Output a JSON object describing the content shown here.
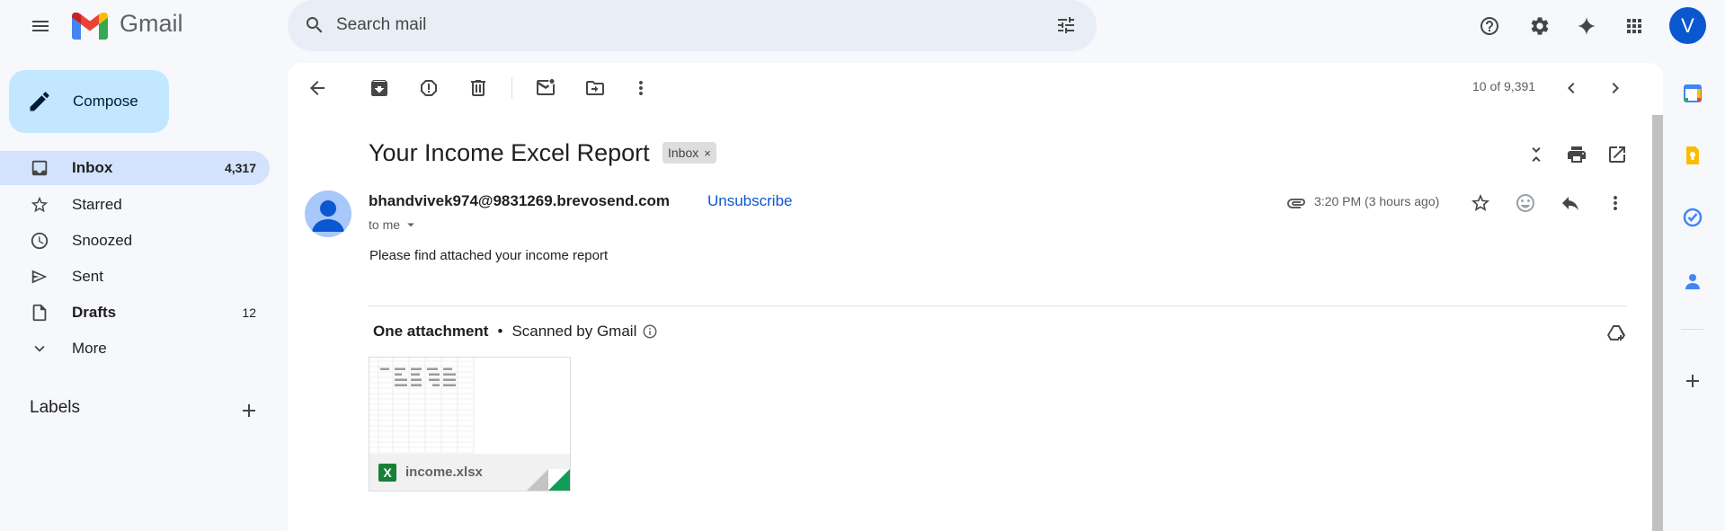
{
  "app": {
    "name": "Gmail",
    "avatar_initial": "V"
  },
  "search": {
    "placeholder": "Search mail"
  },
  "compose": {
    "label": "Compose"
  },
  "sidebar": {
    "items": [
      {
        "label": "Inbox",
        "count": "4,317"
      },
      {
        "label": "Starred",
        "count": ""
      },
      {
        "label": "Snoozed",
        "count": ""
      },
      {
        "label": "Sent",
        "count": ""
      },
      {
        "label": "Drafts",
        "count": "12"
      },
      {
        "label": "More",
        "count": ""
      }
    ],
    "labels_title": "Labels"
  },
  "toolbar": {
    "counter": "10 of 9,391"
  },
  "email": {
    "subject": "Your Income Excel Report",
    "label_chip": "Inbox",
    "label_chip_close": "×",
    "sender": "bhandvivek974@9831269.brevosend.com",
    "unsubscribe": "Unsubscribe",
    "to": "to me",
    "time": "3:20 PM (3 hours ago)",
    "body": "Please find attached your income report"
  },
  "attachments": {
    "header_bold": "One attachment",
    "separator": "•",
    "scanned": "Scanned by Gmail",
    "file_icon_letter": "X",
    "file_name": "income.xlsx"
  },
  "colors": {
    "accent": "#0b57d0",
    "compose_bg": "#c2e7ff",
    "active_nav": "#d3e3fd",
    "excel_green": "#188038"
  }
}
